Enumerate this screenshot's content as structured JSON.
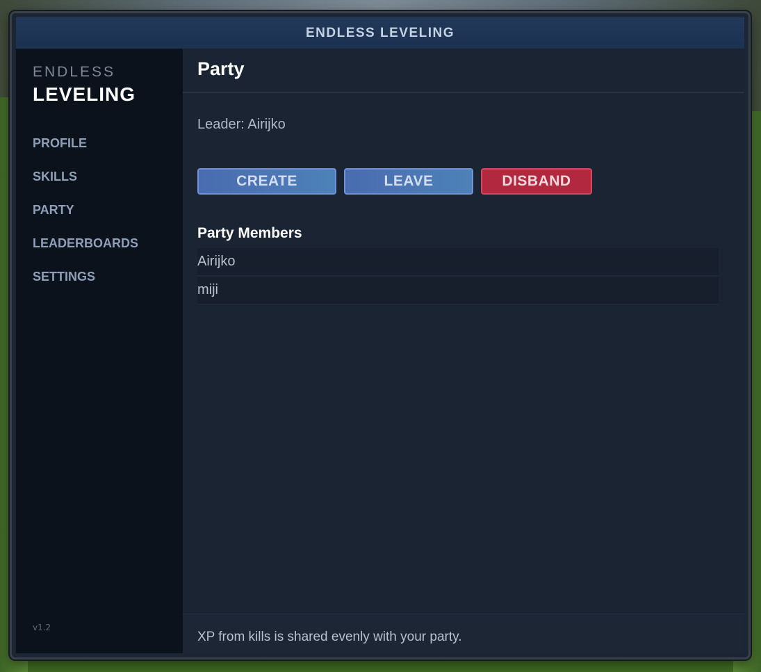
{
  "window": {
    "title": "ENDLESS LEVELING"
  },
  "sidebar": {
    "brand_top": "ENDLESS",
    "brand_main": "LEVELING",
    "items": [
      {
        "label": "PROFILE"
      },
      {
        "label": "SKILLS"
      },
      {
        "label": "PARTY"
      },
      {
        "label": "LEADERBOARDS"
      },
      {
        "label": "SETTINGS"
      }
    ],
    "version": "v1.2"
  },
  "main": {
    "title": "Party",
    "leader_text": "Leader: Airijko",
    "buttons": {
      "create": "CREATE",
      "leave": "LEAVE",
      "disband": "DISBAND"
    },
    "members_title": "Party Members",
    "members": [
      {
        "name": "Airijko"
      },
      {
        "name": "miji"
      }
    ],
    "footer_text": "XP from kills is shared evenly with your party."
  },
  "colors": {
    "accent_blue": "#4d82b8",
    "danger_red": "#b1283f",
    "sidebar_bg": "#0c121b",
    "panel_bg": "#1a2432"
  }
}
